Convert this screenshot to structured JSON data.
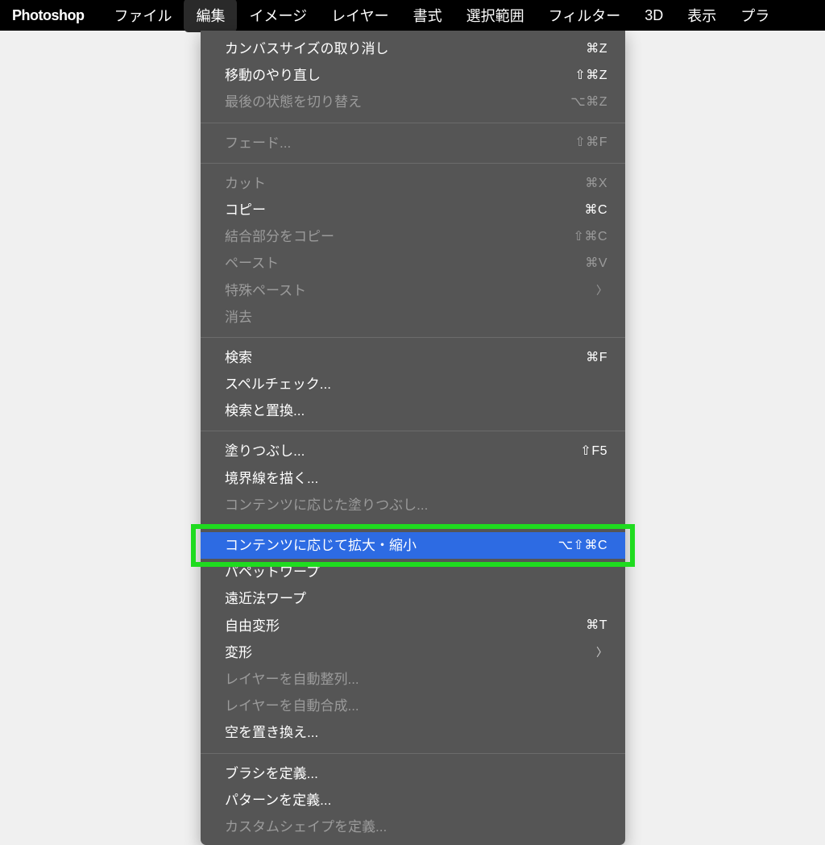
{
  "menubar": {
    "appName": "Photoshop",
    "items": [
      "ファイル",
      "編集",
      "イメージ",
      "レイヤー",
      "書式",
      "選択範囲",
      "フィルター",
      "3D",
      "表示",
      "プラ"
    ],
    "activeIndex": 1
  },
  "dropdown": {
    "groups": [
      [
        {
          "label": "カンバスサイズの取り消し",
          "shortcut": "⌘Z",
          "disabled": false,
          "submenu": false
        },
        {
          "label": "移動のやり直し",
          "shortcut": "⇧⌘Z",
          "disabled": false,
          "submenu": false
        },
        {
          "label": "最後の状態を切り替え",
          "shortcut": "⌥⌘Z",
          "disabled": true,
          "submenu": false
        }
      ],
      [
        {
          "label": "フェード...",
          "shortcut": "⇧⌘F",
          "disabled": true,
          "submenu": false
        }
      ],
      [
        {
          "label": "カット",
          "shortcut": "⌘X",
          "disabled": true,
          "submenu": false
        },
        {
          "label": "コピー",
          "shortcut": "⌘C",
          "disabled": false,
          "submenu": false
        },
        {
          "label": "結合部分をコピー",
          "shortcut": "⇧⌘C",
          "disabled": true,
          "submenu": false
        },
        {
          "label": "ペースト",
          "shortcut": "⌘V",
          "disabled": true,
          "submenu": false
        },
        {
          "label": "特殊ペースト",
          "shortcut": "",
          "disabled": true,
          "submenu": true
        },
        {
          "label": "消去",
          "shortcut": "",
          "disabled": true,
          "submenu": false
        }
      ],
      [
        {
          "label": "検索",
          "shortcut": "⌘F",
          "disabled": false,
          "submenu": false
        },
        {
          "label": "スペルチェック...",
          "shortcut": "",
          "disabled": false,
          "submenu": false
        },
        {
          "label": "検索と置換...",
          "shortcut": "",
          "disabled": false,
          "submenu": false
        }
      ],
      [
        {
          "label": "塗りつぶし...",
          "shortcut": "⇧F5",
          "disabled": false,
          "submenu": false
        },
        {
          "label": "境界線を描く...",
          "shortcut": "",
          "disabled": false,
          "submenu": false
        },
        {
          "label": "コンテンツに応じた塗りつぶし...",
          "shortcut": "",
          "disabled": true,
          "submenu": false
        }
      ],
      [
        {
          "label": "コンテンツに応じて拡大・縮小",
          "shortcut": "⌥⇧⌘C",
          "disabled": false,
          "submenu": false,
          "highlighted": true,
          "outlined": true
        },
        {
          "label": "パペットワープ",
          "shortcut": "",
          "disabled": false,
          "submenu": false
        },
        {
          "label": "遠近法ワープ",
          "shortcut": "",
          "disabled": false,
          "submenu": false
        },
        {
          "label": "自由変形",
          "shortcut": "⌘T",
          "disabled": false,
          "submenu": false
        },
        {
          "label": "変形",
          "shortcut": "",
          "disabled": false,
          "submenu": true
        },
        {
          "label": "レイヤーを自動整列...",
          "shortcut": "",
          "disabled": true,
          "submenu": false
        },
        {
          "label": "レイヤーを自動合成...",
          "shortcut": "",
          "disabled": true,
          "submenu": false
        },
        {
          "label": "空を置き換え...",
          "shortcut": "",
          "disabled": false,
          "submenu": false
        }
      ],
      [
        {
          "label": "ブラシを定義...",
          "shortcut": "",
          "disabled": false,
          "submenu": false
        },
        {
          "label": "パターンを定義...",
          "shortcut": "",
          "disabled": false,
          "submenu": false
        },
        {
          "label": "カスタムシェイプを定義...",
          "shortcut": "",
          "disabled": true,
          "submenu": false
        }
      ]
    ]
  }
}
